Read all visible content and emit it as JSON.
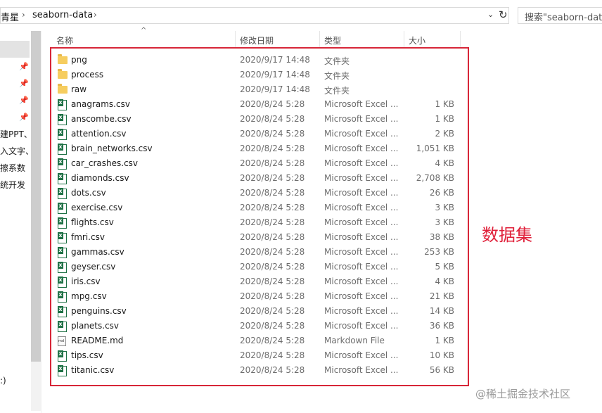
{
  "breadcrumb": {
    "partial_root": "青星",
    "folder": "seaborn-data"
  },
  "search": {
    "placeholder": "搜索\"seaborn-data\""
  },
  "nav": {
    "partial_items": [
      "建PPT、",
      "入文字、",
      "擦系数",
      "统开发"
    ],
    "bottom_partial": ":)"
  },
  "columns": {
    "name": "名称",
    "date": "修改日期",
    "type": "类型",
    "size": "大小"
  },
  "files": [
    {
      "name": "png",
      "date": "2020/9/17 14:48",
      "type": "文件夹",
      "size": "",
      "icon": "folder-icon"
    },
    {
      "name": "process",
      "date": "2020/9/17 14:48",
      "type": "文件夹",
      "size": "",
      "icon": "folder-icon"
    },
    {
      "name": "raw",
      "date": "2020/9/17 14:48",
      "type": "文件夹",
      "size": "",
      "icon": "folder-icon"
    },
    {
      "name": "anagrams.csv",
      "date": "2020/8/24 5:28",
      "type": "Microsoft Excel ...",
      "size": "1 KB",
      "icon": "excel-csv-icon"
    },
    {
      "name": "anscombe.csv",
      "date": "2020/8/24 5:28",
      "type": "Microsoft Excel ...",
      "size": "1 KB",
      "icon": "excel-csv-icon"
    },
    {
      "name": "attention.csv",
      "date": "2020/8/24 5:28",
      "type": "Microsoft Excel ...",
      "size": "2 KB",
      "icon": "excel-csv-icon"
    },
    {
      "name": "brain_networks.csv",
      "date": "2020/8/24 5:28",
      "type": "Microsoft Excel ...",
      "size": "1,051 KB",
      "icon": "excel-csv-icon"
    },
    {
      "name": "car_crashes.csv",
      "date": "2020/8/24 5:28",
      "type": "Microsoft Excel ...",
      "size": "4 KB",
      "icon": "excel-csv-icon"
    },
    {
      "name": "diamonds.csv",
      "date": "2020/8/24 5:28",
      "type": "Microsoft Excel ...",
      "size": "2,708 KB",
      "icon": "excel-csv-icon"
    },
    {
      "name": "dots.csv",
      "date": "2020/8/24 5:28",
      "type": "Microsoft Excel ...",
      "size": "26 KB",
      "icon": "excel-csv-icon"
    },
    {
      "name": "exercise.csv",
      "date": "2020/8/24 5:28",
      "type": "Microsoft Excel ...",
      "size": "3 KB",
      "icon": "excel-csv-icon"
    },
    {
      "name": "flights.csv",
      "date": "2020/8/24 5:28",
      "type": "Microsoft Excel ...",
      "size": "3 KB",
      "icon": "excel-csv-icon"
    },
    {
      "name": "fmri.csv",
      "date": "2020/8/24 5:28",
      "type": "Microsoft Excel ...",
      "size": "38 KB",
      "icon": "excel-csv-icon"
    },
    {
      "name": "gammas.csv",
      "date": "2020/8/24 5:28",
      "type": "Microsoft Excel ...",
      "size": "253 KB",
      "icon": "excel-csv-icon"
    },
    {
      "name": "geyser.csv",
      "date": "2020/8/24 5:28",
      "type": "Microsoft Excel ...",
      "size": "5 KB",
      "icon": "excel-csv-icon"
    },
    {
      "name": "iris.csv",
      "date": "2020/8/24 5:28",
      "type": "Microsoft Excel ...",
      "size": "4 KB",
      "icon": "excel-csv-icon"
    },
    {
      "name": "mpg.csv",
      "date": "2020/8/24 5:28",
      "type": "Microsoft Excel ...",
      "size": "21 KB",
      "icon": "excel-csv-icon"
    },
    {
      "name": "penguins.csv",
      "date": "2020/8/24 5:28",
      "type": "Microsoft Excel ...",
      "size": "14 KB",
      "icon": "excel-csv-icon"
    },
    {
      "name": "planets.csv",
      "date": "2020/8/24 5:28",
      "type": "Microsoft Excel ...",
      "size": "36 KB",
      "icon": "excel-csv-icon"
    },
    {
      "name": "README.md",
      "date": "2020/8/24 5:28",
      "type": "Markdown File",
      "size": "1 KB",
      "icon": "markdown-file-icon"
    },
    {
      "name": "tips.csv",
      "date": "2020/8/24 5:28",
      "type": "Microsoft Excel ...",
      "size": "10 KB",
      "icon": "excel-csv-icon"
    },
    {
      "name": "titanic.csv",
      "date": "2020/8/24 5:28",
      "type": "Microsoft Excel ...",
      "size": "56 KB",
      "icon": "excel-csv-icon"
    }
  ],
  "annotation": {
    "label": "数据集",
    "color": "#e0203a"
  },
  "watermark": "@稀土掘金技术社区"
}
